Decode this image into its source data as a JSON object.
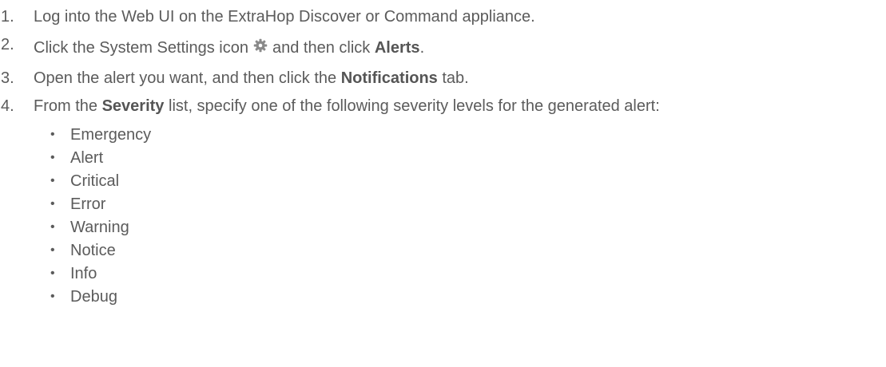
{
  "steps": [
    {
      "number": "1.",
      "text": "Log into the Web UI on the ExtraHop Discover or Command appliance."
    },
    {
      "number": "2.",
      "before": "Click the System Settings icon",
      "icon": "gear-icon",
      "middle": "and then click",
      "bold": "Alerts",
      "after": "."
    },
    {
      "number": "3.",
      "before": "Open the alert you want, and then click the",
      "bold": "Notifications",
      "after": "tab."
    },
    {
      "number": "4.",
      "before": "From the",
      "bold": "Severity",
      "after": "list, specify one of the following severity levels for the generated alert:"
    }
  ],
  "bullet_glyph": "•",
  "severity_levels": [
    "Emergency",
    "Alert",
    "Critical",
    "Error",
    "Warning",
    "Notice",
    "Info",
    "Debug"
  ],
  "colors": {
    "text": "#5b5b5b",
    "icon": "#8a8a8a"
  }
}
